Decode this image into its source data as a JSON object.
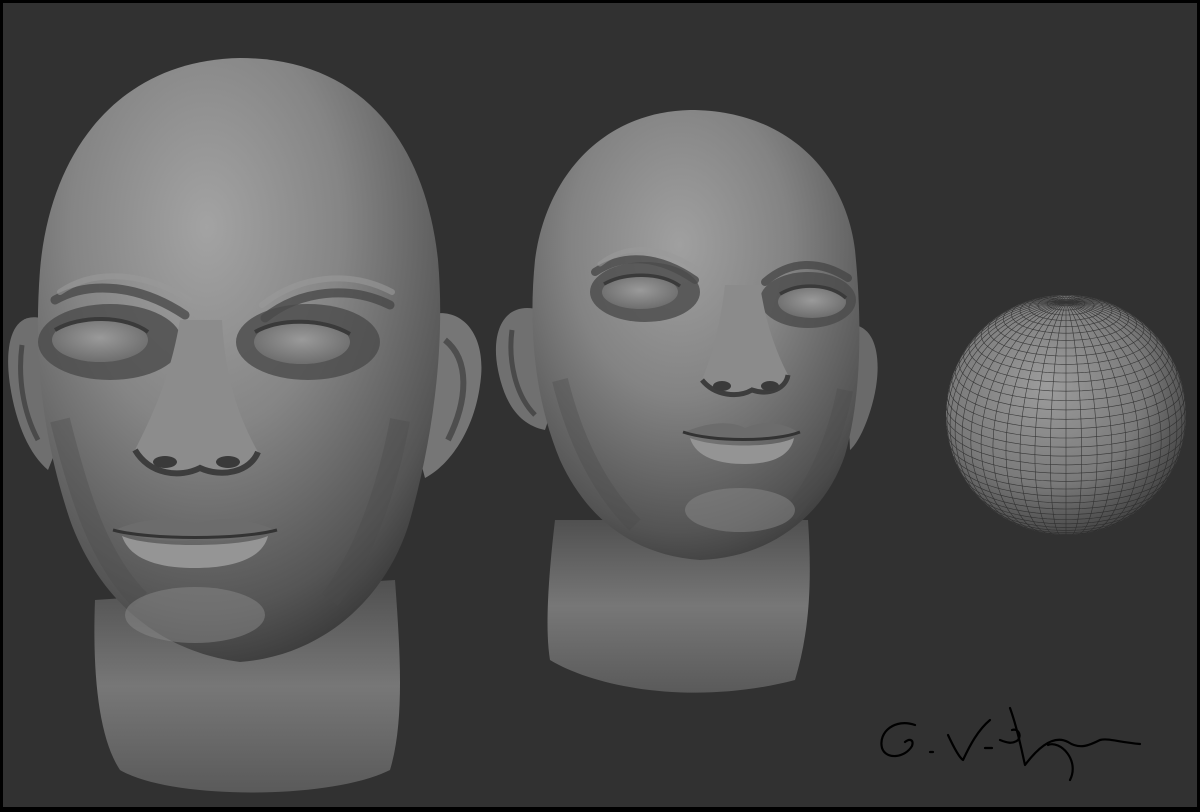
{
  "scene": {
    "objects": [
      {
        "kind": "sculpted-head",
        "view": "front"
      },
      {
        "kind": "sculpted-head",
        "view": "three-quarter"
      },
      {
        "kind": "sphere",
        "display": "wireframe-polyframe"
      }
    ],
    "signature": "G.Vichera",
    "colors": {
      "frame": "#000000",
      "background": "#313131",
      "clay_light": "#a0a0a0",
      "clay_mid": "#7a7a7a",
      "clay_dark": "#3a3a3a",
      "signature_ink": "#000000"
    }
  }
}
